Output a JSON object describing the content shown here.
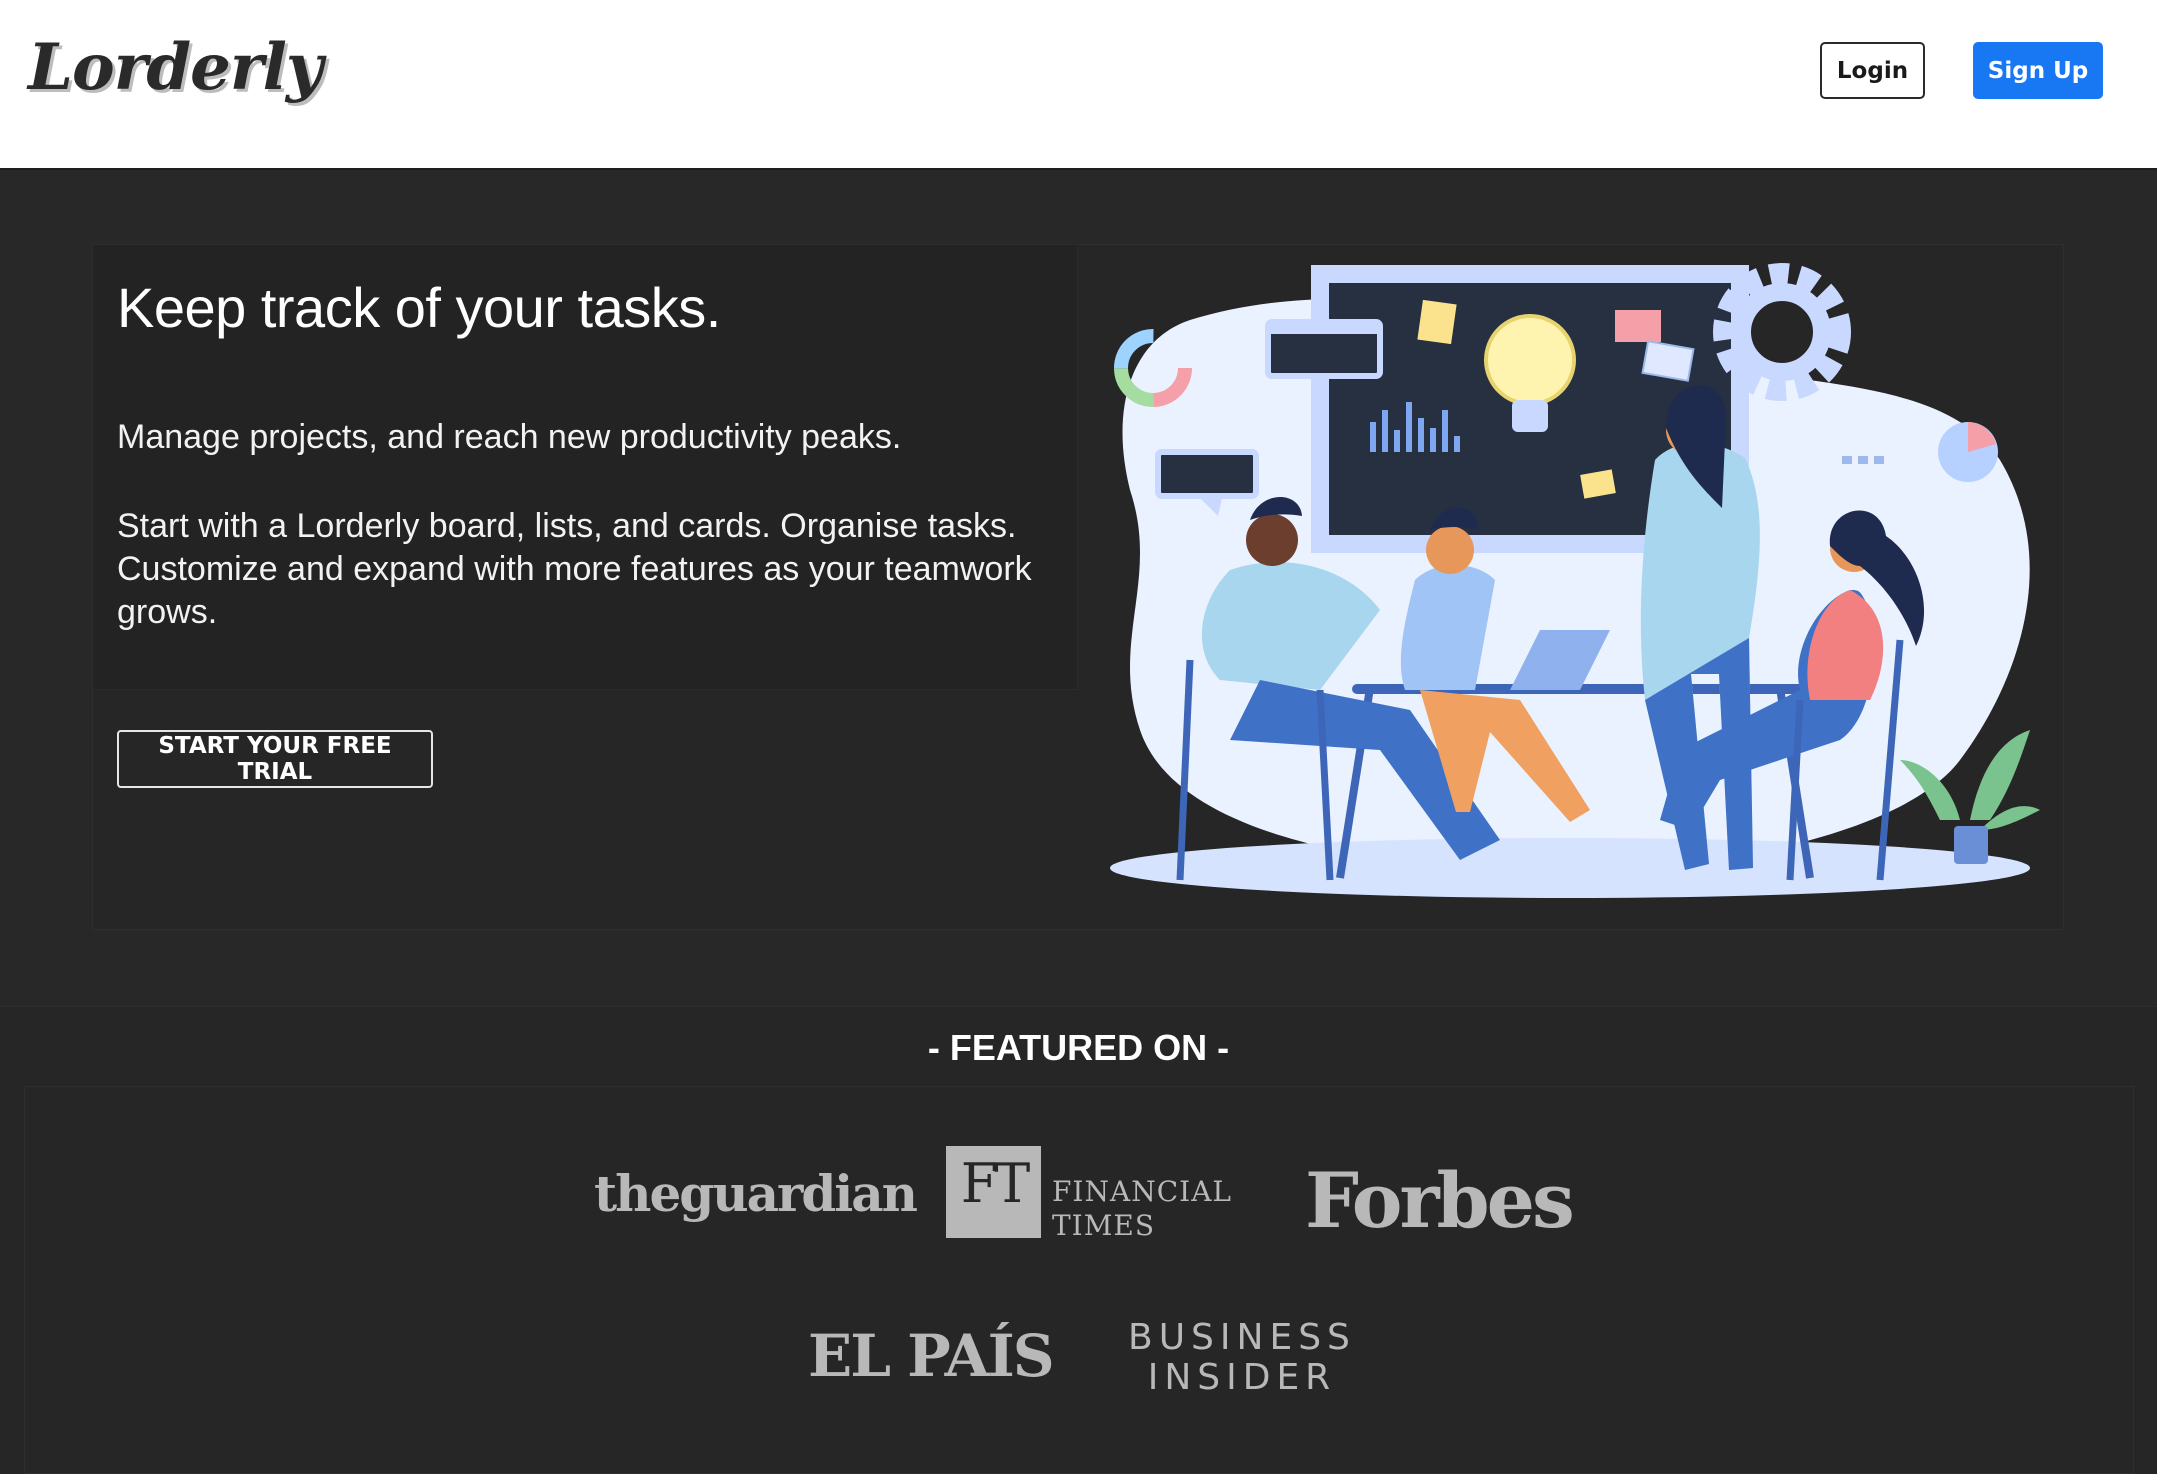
{
  "header": {
    "logo": "Lorderly",
    "login_label": "Login",
    "signup_label": "Sign Up"
  },
  "hero": {
    "title": "Keep track of your tasks.",
    "subtitle": "Manage projects, and reach new productivity peaks.",
    "description": "Start with a Lorderly board, lists, and cards. Organise tasks. Customize and expand with more features as your teamwork grows.",
    "cta_label": "START YOUR FREE TRIAL",
    "illustration_icon": "team-collaboration-illustration"
  },
  "featured": {
    "title": "- FEATURED ON -",
    "logos": {
      "guardian": "theguardian",
      "ft_mark": "FT",
      "ft_line1": "FINANCIAL",
      "ft_line2": "TIMES",
      "forbes": "Forbes",
      "elpais": "EL PAÍS",
      "bi_line1": "BUSINESS",
      "bi_line2": "INSIDER"
    }
  },
  "colors": {
    "accent": "#1877f2",
    "background": "#282828",
    "logo_gray": "#b8b8b8"
  }
}
